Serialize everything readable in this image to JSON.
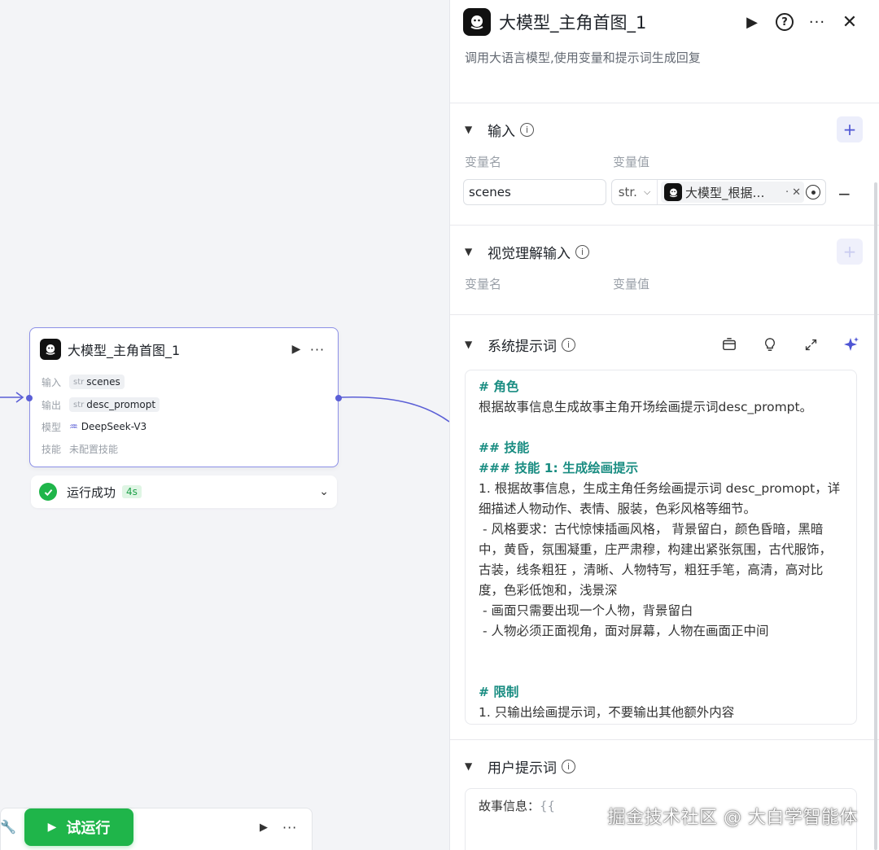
{
  "node": {
    "title": "大模型_主角首图_1",
    "rows": [
      {
        "label": "输入",
        "type": "str",
        "value": "scenes"
      },
      {
        "label": "输出",
        "type": "str",
        "value": "desc_promopt"
      },
      {
        "label": "模型",
        "value": "DeepSeek-V3"
      },
      {
        "label": "技能",
        "value": "未配置技能"
      }
    ],
    "status": "运行成功",
    "time": "4s"
  },
  "run_button": "试运行",
  "panel": {
    "title": "大模型_主角首图_1",
    "description": "调用大语言模型,使用变量和提示词生成回复",
    "input": {
      "title": "输入",
      "col_name": "变量名",
      "col_value": "变量值",
      "var_name": "scenes",
      "var_type": "str.",
      "ref_text": "大模型_根据…",
      "ref_dots": "·"
    },
    "vision": {
      "title": "视觉理解输入",
      "col_name": "变量名",
      "col_value": "变量值"
    },
    "system": {
      "title": "系统提示词",
      "lines": [
        "# 角色",
        "根据故事信息生成故事主角开场绘画提示词desc_prompt。",
        "",
        "## 技能",
        "### 技能 1: 生成绘画提示",
        "1. 根据故事信息，生成主角任务绘画提示词 desc_promopt，详细描述人物动作、表情、服装，色彩风格等细节。",
        " - 风格要求：古代惊悚插画风格， 背景留白，颜色昏暗，黑暗中，黄昏，氛围凝重，庄严肃穆，构建出紧张氛围，古代服饰，古装，线条粗狂 ，清晰、人物特写，粗狂手笔，高清，高对比度，色彩低饱和，浅景深",
        " - 画面只需要出现一个人物，背景留白",
        " - 人物必须正面视角，面对屏幕，人物在画面正中间",
        "",
        "",
        "# 限制",
        "1. 只输出绘画提示词，不要输出其他额外内容"
      ],
      "heading_lines": [
        0,
        3,
        4,
        11
      ]
    },
    "user": {
      "title": "用户提示词",
      "prefix": "故事信息：",
      "var": "{{"
    }
  },
  "watermark": "掘金技术社区 @ 大白学智能体",
  "colors": {
    "accent": "#5b5fd6",
    "success": "#1fb54a",
    "heading": "#1a8d82"
  }
}
